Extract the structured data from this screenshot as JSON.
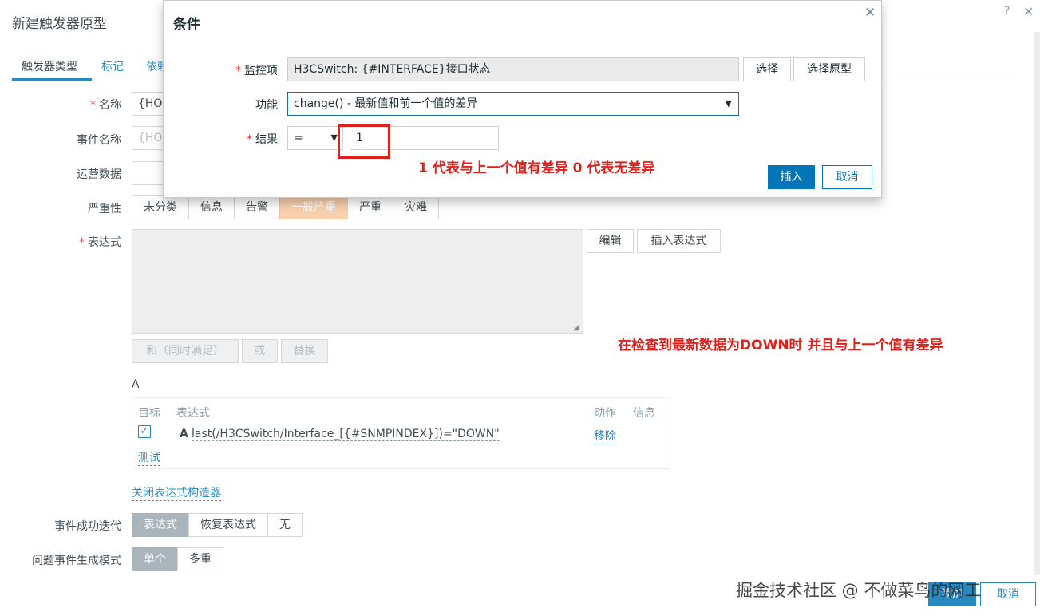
{
  "page": {
    "title": "新建触发器原型",
    "help_icon": "?",
    "close_icon": "✕",
    "tabs": [
      "触发器类型",
      "标记",
      "依赖"
    ],
    "tab_depend_visible": "依赖",
    "fields": {
      "name_label": "名称",
      "name_value": "{HOS",
      "event_name_label": "事件名称",
      "event_name_placeholder": "{HOS",
      "opdata_label": "运营数据",
      "severity_label": "严重性",
      "expression_label": "表达式"
    },
    "severity": [
      "未分类",
      "信息",
      "告警",
      "一般严重",
      "严重",
      "灾难"
    ],
    "severity_selected": "一般严重",
    "expr_buttons": {
      "edit": "编辑",
      "insert": "插入表达式"
    },
    "logic_buttons": {
      "and": "和（同时满足）",
      "or": "或",
      "replace": "替换"
    },
    "constructor": {
      "group_label": "A",
      "headers": {
        "target": "目标",
        "expression": "表达式",
        "action": "动作",
        "info": "信息"
      },
      "row": {
        "letter": "A",
        "expression": "last(/H3CSwitch/Interface_[{#SNMPINDEX}])=\"DOWN\"",
        "action": "移除"
      },
      "test_link": "测试",
      "close_link": "关闭表达式构造器"
    },
    "recovery": {
      "label": "事件成功迭代",
      "options": [
        "表达式",
        "恢复表达式",
        "无"
      ],
      "selected": "表达式"
    },
    "problem_mode": {
      "label": "问题事件生成模式",
      "options": [
        "单个",
        "多重"
      ],
      "selected": "单个"
    },
    "footer": {
      "add": "添加",
      "cancel": "取消"
    }
  },
  "dialog": {
    "title": "条件",
    "item_label": "监控项",
    "item_value": "H3CSwitch: {#INTERFACE}接口状态",
    "select_button": "选择",
    "select_proto_button": "选择原型",
    "function_label": "功能",
    "function_value": "change() - 最新值和前一个值的差异",
    "result_label": "结果",
    "operator_value": "=",
    "result_value": "1",
    "insert_button": "插入",
    "cancel_button": "取消"
  },
  "annotations": {
    "result_note": "1 代表与上一个值有差异 0 代表无差异",
    "expr_note": "在检查到最新数据为DOWN时 并且与上一个值有差异",
    "watermark": "掘金技术社区 @ 不做菜鸟的网工"
  },
  "colors": {
    "primary": "#0275b8",
    "highlight": "#e0201a",
    "severity_selected": "#f7c8a0"
  }
}
